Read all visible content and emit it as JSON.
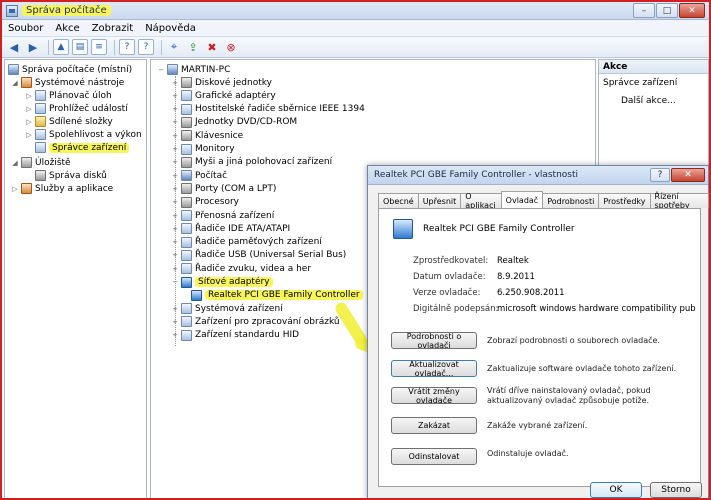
{
  "window": {
    "title": "Správa počítače",
    "controls": {
      "minimize": "–",
      "maximize": "□",
      "close": "✕"
    }
  },
  "menu": [
    "Soubor",
    "Akce",
    "Zobrazit",
    "Nápověda"
  ],
  "toolbar": {
    "icons": [
      "back-arrow-icon",
      "forward-arrow-icon",
      "folder-up-icon",
      "properties-icon",
      "list-icon",
      "help-icon",
      "help-box-icon",
      "scan-icon",
      "update-driver-icon",
      "disable-device-icon",
      "uninstall-device-icon"
    ],
    "glyphs": [
      "◀",
      "▶",
      "▲",
      "▤",
      "≡",
      "?",
      "?",
      "⌖",
      "⇪",
      "✖",
      "⊗"
    ]
  },
  "left_tree": [
    {
      "label": "Správa počítače (místní)",
      "indent": 0,
      "expander": "",
      "icon": "pc"
    },
    {
      "label": "Systémové nástroje",
      "indent": 1,
      "expander": "◢",
      "icon": "tool"
    },
    {
      "label": "Plánovač úloh",
      "indent": 2,
      "expander": "▷",
      "icon": "clock"
    },
    {
      "label": "Prohlížeč událostí",
      "indent": 2,
      "expander": "▷",
      "icon": "event"
    },
    {
      "label": "Sdílené složky",
      "indent": 2,
      "expander": "▷",
      "icon": "folder"
    },
    {
      "label": "Spolehlivost a výkon",
      "indent": 2,
      "expander": "▷",
      "icon": "perf"
    },
    {
      "label": "Správce zařízení",
      "indent": 2,
      "expander": "",
      "icon": "device",
      "highlight": true
    },
    {
      "label": "Úložiště",
      "indent": 1,
      "expander": "◢",
      "icon": "disk"
    },
    {
      "label": "Správa disků",
      "indent": 2,
      "expander": "",
      "icon": "disk"
    },
    {
      "label": "Služby a aplikace",
      "indent": 1,
      "expander": "▷",
      "icon": "tool"
    }
  ],
  "device_tree": {
    "root": "MARTIN-PC",
    "items": [
      {
        "label": "Diskové jednotky",
        "expander": "+",
        "icon": "disk"
      },
      {
        "label": "Grafické adaptéry",
        "expander": "+",
        "icon": "display"
      },
      {
        "label": "Hostitelské řadiče sběrnice IEEE 1394",
        "expander": "+",
        "icon": "controller"
      },
      {
        "label": "Jednotky DVD/CD-ROM",
        "expander": "+",
        "icon": "disk"
      },
      {
        "label": "Klávesnice",
        "expander": "+",
        "icon": "keyboard"
      },
      {
        "label": "Monitory",
        "expander": "+",
        "icon": "display"
      },
      {
        "label": "Myši a jiná polohovací zařízení",
        "expander": "+",
        "icon": "mouse"
      },
      {
        "label": "Počítač",
        "expander": "+",
        "icon": "pc"
      },
      {
        "label": "Porty (COM a LPT)",
        "expander": "+",
        "icon": "port"
      },
      {
        "label": "Procesory",
        "expander": "+",
        "icon": "cpu"
      },
      {
        "label": "Přenosná zařízení",
        "expander": "+",
        "icon": "device"
      },
      {
        "label": "Řadiče IDE ATA/ATAPI",
        "expander": "+",
        "icon": "controller"
      },
      {
        "label": "Řadiče paměťových zařízení",
        "expander": "+",
        "icon": "controller"
      },
      {
        "label": "Řadiče USB (Universal Serial Bus)",
        "expander": "+",
        "icon": "usb"
      },
      {
        "label": "Řadiče zvuku, videa a her",
        "expander": "+",
        "icon": "sound"
      },
      {
        "label": "Síťové adaptéry",
        "expander": "−",
        "icon": "net",
        "highlight": true
      },
      {
        "label": "Realtek PCI GBE Family Controller",
        "expander": "",
        "icon": "net",
        "child": true,
        "highlight": true
      },
      {
        "label": "Systémová zařízení",
        "expander": "+",
        "icon": "device"
      },
      {
        "label": "Zařízení pro zpracování obrázků",
        "expander": "+",
        "icon": "camera"
      },
      {
        "label": "Zařízení standardu HID",
        "expander": "+",
        "icon": "device"
      }
    ]
  },
  "actions": {
    "header": "Akce",
    "section": "Správce zařízení",
    "more": "Další akce..."
  },
  "dialog": {
    "title": "Realtek PCI GBE Family Controller - vlastnosti",
    "help_btn": "?",
    "close_btn": "✕",
    "tabs": [
      "Obecné",
      "Upřesnit",
      "O aplikaci",
      "Ovladač",
      "Podrobnosti",
      "Prostředky",
      "Řízení spotřeby"
    ],
    "active_tab": 3,
    "device_name": "Realtek PCI GBE Family Controller",
    "info": [
      {
        "label": "Zprostředkovatel:",
        "value": "Realtek"
      },
      {
        "label": "Datum ovladače:",
        "value": "8.9.2011"
      },
      {
        "label": "Verze ovladače:",
        "value": "6.250.908.2011"
      },
      {
        "label": "Digitálně podepsán:",
        "value": "microsoft windows hardware compatibility pub"
      }
    ],
    "buttons": [
      {
        "label": "Podrobnosti o ovladači",
        "desc": "Zobrazí podrobnosti o souborech ovladače."
      },
      {
        "label": "Aktualizovat ovladač...",
        "desc": "Zaktualizuje software ovladače tohoto zařízení."
      },
      {
        "label": "Vrátit změny ovladače",
        "desc": "Vrátí dříve nainstalovaný ovladač, pokud aktualizovaný ovladač způsobuje potíže."
      },
      {
        "label": "Zakázat",
        "desc": "Zakáže vybrané zařízení."
      },
      {
        "label": "Odinstalovat",
        "desc": "Odinstaluje ovladač."
      }
    ],
    "ok": "OK",
    "cancel": "Storno"
  }
}
